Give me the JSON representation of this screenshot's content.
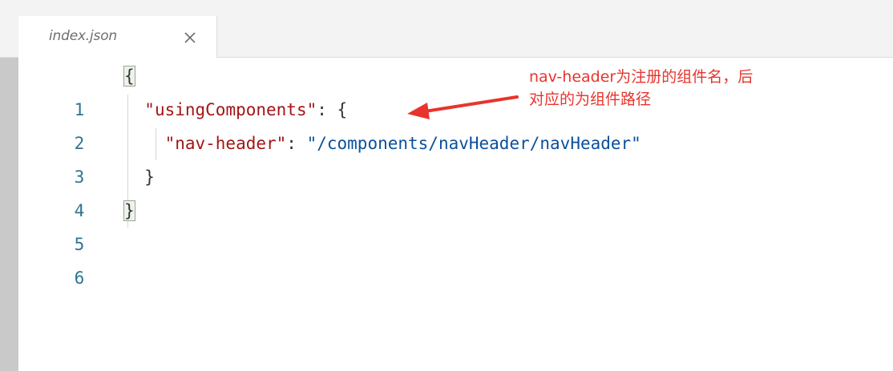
{
  "tab": {
    "label": "index.json",
    "close_glyph": "×"
  },
  "lines": [
    {
      "number": "1"
    },
    {
      "number": "2"
    },
    {
      "number": "3"
    },
    {
      "number": "4"
    },
    {
      "number": "5"
    },
    {
      "number": "6"
    }
  ],
  "code": {
    "open_brace": "{",
    "key_using": "\"usingComponents\"",
    "colon_space": ": ",
    "inner_open": "{",
    "key_nav": "\"nav-header\"",
    "value_nav": "\"/components/navHeader/navHeader\"",
    "inner_close": "}",
    "close_brace": "}"
  },
  "annotation": {
    "line1": "nav-header为注册的组件名，后",
    "line2": "对应的为组件路径",
    "color": "#e8342c"
  },
  "colors": {
    "line_number": "#2c7591",
    "key": "#a31515",
    "string": "#0b4f9c"
  },
  "icons": {
    "close": "close-icon",
    "arrow": "arrow-icon"
  }
}
